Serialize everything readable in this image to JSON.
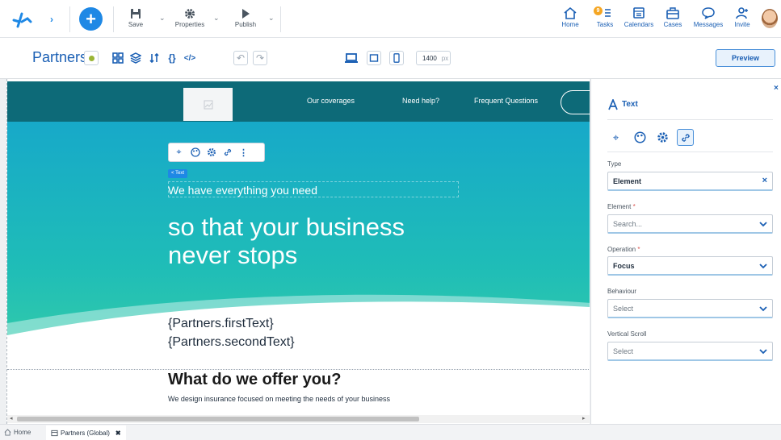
{
  "topbar": {
    "save_label": "Save",
    "properties_label": "Properties",
    "publish_label": "Publish",
    "nav": [
      {
        "label": "Home",
        "icon": "home-icon"
      },
      {
        "label": "Tasks",
        "icon": "tasks-icon",
        "badge": "9"
      },
      {
        "label": "Calendars",
        "icon": "calendar-icon"
      },
      {
        "label": "Cases",
        "icon": "briefcase-icon"
      },
      {
        "label": "Messages",
        "icon": "chat-icon"
      },
      {
        "label": "Invite",
        "icon": "invite-icon"
      }
    ]
  },
  "toolbar": {
    "form_title": "Partners",
    "width_value": "1400",
    "width_unit": "px",
    "preview_label": "Preview"
  },
  "site": {
    "nav_links": [
      "Our coverages",
      "Need help?",
      "Frequent Questions"
    ],
    "element_tag": "< Text",
    "hero_small": "We have everything you need",
    "hero_big_line1": "so that your business",
    "hero_big_line2": "never stops",
    "first_text": "{Partners.firstText}",
    "second_text": "{Partners.secondText}",
    "offer_title": "What do we offer you?",
    "offer_subtitle": "We design insurance focused on meeting the needs of your business"
  },
  "panel": {
    "title": "Text",
    "type_label": "Type",
    "type_value": "Element",
    "element_label": "Element",
    "element_placeholder": "Search...",
    "operation_label": "Operation",
    "operation_value": "Focus",
    "behaviour_label": "Behaviour",
    "behaviour_value": "Select",
    "vscroll_label": "Vertical Scroll",
    "vscroll_value": "Select",
    "required_mark": "*"
  },
  "bottom": {
    "home_tab": "Home",
    "partners_tab": "Partners (Global)"
  },
  "colors": {
    "brand_blue": "#1e88e5",
    "nav_blue": "#1a5fb4",
    "badge_orange": "#f5a623",
    "site_nav": "#0d6a78",
    "hero_top": "#17a9c9",
    "hero_bottom": "#3bd1a3"
  }
}
